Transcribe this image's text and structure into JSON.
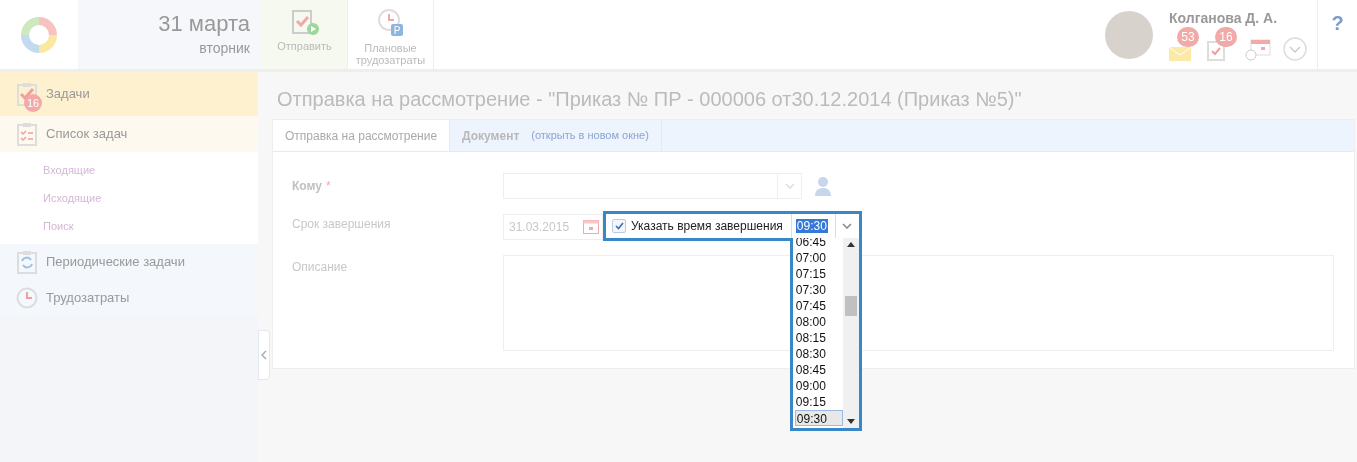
{
  "header": {
    "date": "31 марта",
    "weekday": "вторник",
    "actions": [
      {
        "kind": "send",
        "label": "Отправить"
      },
      {
        "kind": "plan",
        "label": "Плановые трудозатраты",
        "badge": "P"
      }
    ],
    "user": {
      "name": "Колганова Д. А.",
      "mail_count": "53",
      "task_count": "16"
    },
    "help": "?"
  },
  "sidebar": {
    "items": [
      {
        "kind": "tasks",
        "label": "Задачи",
        "badge": "16",
        "selected": true
      },
      {
        "kind": "list",
        "label": "Список задач",
        "selected": false,
        "children": [
          {
            "label": "Входящие"
          },
          {
            "label": "Исходящие"
          },
          {
            "label": "Поиск"
          }
        ]
      },
      {
        "kind": "periodic",
        "label": "Периодические задачи",
        "selected": false
      },
      {
        "kind": "time",
        "label": "Трудозатраты",
        "selected": false
      }
    ]
  },
  "page_title": "Отправка на рассмотрение - \"Приказ № ПР - 000006 от30.12.2014 (Приказ №5)\"",
  "tabs": [
    {
      "label": "Отправка на рассмотрение",
      "selected": true
    },
    {
      "label": "Документ",
      "selected": false,
      "note": "(открыть в новом окне)"
    }
  ],
  "form": {
    "to_label": "Кому",
    "required_mark": "*",
    "due_label": "Срок завершения",
    "due_date": "31.03.2015",
    "time_checkbox": {
      "label": "Указать время завершения",
      "checked": true
    },
    "time_value": "09:30",
    "description_label": "Описание",
    "time_options": [
      {
        "label": "06:45",
        "selected": false
      },
      {
        "label": "07:00",
        "selected": false
      },
      {
        "label": "07:15",
        "selected": false
      },
      {
        "label": "07:30",
        "selected": false
      },
      {
        "label": "07:45",
        "selected": false
      },
      {
        "label": "08:00",
        "selected": false
      },
      {
        "label": "08:15",
        "selected": false
      },
      {
        "label": "08:30",
        "selected": false
      },
      {
        "label": "08:45",
        "selected": false
      },
      {
        "label": "09:00",
        "selected": false
      },
      {
        "label": "09:15",
        "selected": false
      },
      {
        "label": "09:30",
        "selected": true
      }
    ]
  }
}
